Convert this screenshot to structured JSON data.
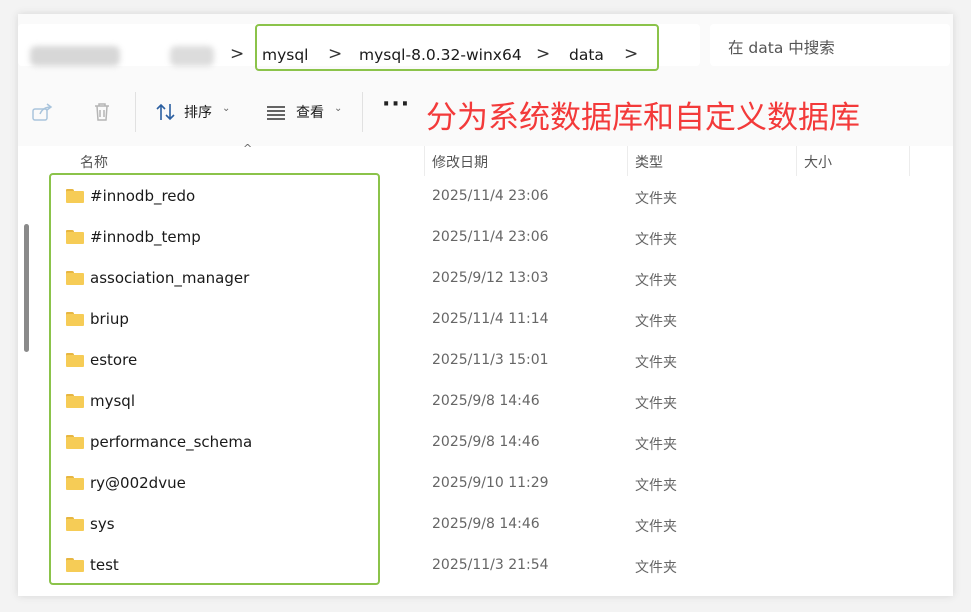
{
  "address_bar": {
    "crumbs": [
      "mysql",
      "mysql-8.0.32-winx64",
      "data"
    ],
    "separator": ">"
  },
  "search": {
    "placeholder": "在 data 中搜索"
  },
  "toolbar": {
    "sort_label": "排序",
    "view_label": "查看",
    "more_label": "···"
  },
  "annotation": {
    "text": "分为系统数据库和自定义数据库",
    "color": "#f33a3a"
  },
  "columns": {
    "name": "名称",
    "modified": "修改日期",
    "type": "类型",
    "size": "大小"
  },
  "files": [
    {
      "name": "#innodb_redo",
      "modified": "2025/11/4 23:06",
      "type": "文件夹"
    },
    {
      "name": "#innodb_temp",
      "modified": "2025/11/4 23:06",
      "type": "文件夹"
    },
    {
      "name": "association_manager",
      "modified": "2025/9/12 13:03",
      "type": "文件夹"
    },
    {
      "name": "briup",
      "modified": "2025/11/4 11:14",
      "type": "文件夹"
    },
    {
      "name": "estore",
      "modified": "2025/11/3 15:01",
      "type": "文件夹"
    },
    {
      "name": "mysql",
      "modified": "2025/9/8 14:46",
      "type": "文件夹"
    },
    {
      "name": "performance_schema",
      "modified": "2025/9/8 14:46",
      "type": "文件夹"
    },
    {
      "name": "ry@002dvue",
      "modified": "2025/9/10 11:29",
      "type": "文件夹"
    },
    {
      "name": "sys",
      "modified": "2025/9/8 14:46",
      "type": "文件夹"
    },
    {
      "name": "test",
      "modified": "2025/11/3 21:54",
      "type": "文件夹"
    }
  ],
  "colors": {
    "highlight_border": "#8bc34a",
    "folder": "#f6cc56"
  }
}
